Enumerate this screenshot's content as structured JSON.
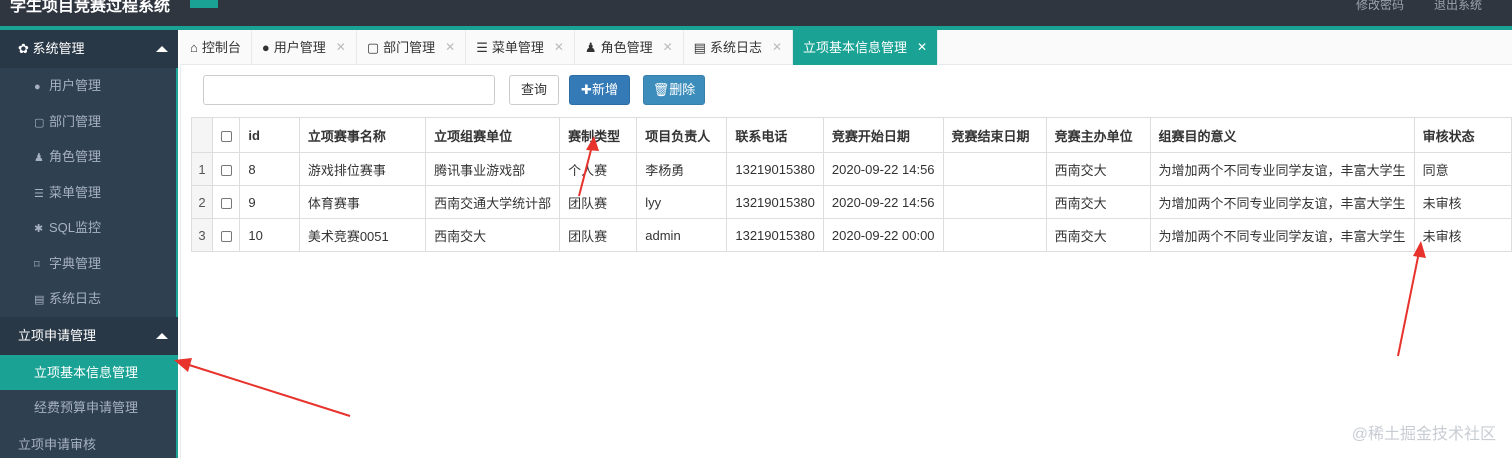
{
  "topbar": {
    "brand": "学生项目竞赛过程系统",
    "right_links": [
      "修改密码",
      "退出系统"
    ]
  },
  "sidebar": {
    "group1": {
      "label": "系统管理",
      "icon": "gear-icon"
    },
    "items": [
      {
        "label": "用户管理",
        "icon": "user-icon"
      },
      {
        "label": "部门管理",
        "icon": "doc-icon"
      },
      {
        "label": "角色管理",
        "icon": "users-icon"
      },
      {
        "label": "菜单管理",
        "icon": "list-icon"
      },
      {
        "label": "SQL监控",
        "icon": "bug-icon"
      },
      {
        "label": "字典管理",
        "icon": "bookmark-icon"
      },
      {
        "label": "系统日志",
        "icon": "file-icon"
      }
    ],
    "group2": {
      "label": "立项申请管理"
    },
    "sub_items": [
      {
        "label": "立项基本信息管理"
      },
      {
        "label": "经费预算申请管理"
      }
    ],
    "group3": {
      "label": "立项申请审核"
    }
  },
  "tabs": [
    {
      "label": "控制台",
      "icon": "home-icon",
      "closable": false
    },
    {
      "label": "用户管理",
      "icon": "user-icon",
      "closable": true
    },
    {
      "label": "部门管理",
      "icon": "doc-icon",
      "closable": true
    },
    {
      "label": "菜单管理",
      "icon": "list-icon",
      "closable": true
    },
    {
      "label": "角色管理",
      "icon": "users-icon",
      "closable": true
    },
    {
      "label": "系统日志",
      "icon": "file-icon",
      "closable": true
    },
    {
      "label": "立项基本信息管理",
      "icon": "",
      "closable": true
    }
  ],
  "toolbar": {
    "search_placeholder": "",
    "query_label": "查询",
    "add_label": "新增",
    "delete_label": "删除"
  },
  "table": {
    "headers": [
      "id",
      "立项赛事名称",
      "立项组赛单位",
      "赛制类型",
      "项目负责人",
      "联系电话",
      "竞赛开始日期",
      "竞赛结束日期",
      "竞赛主办单位",
      "组赛目的意义",
      "审核状态"
    ],
    "rows": [
      {
        "rn": "1",
        "cells": [
          "8",
          "游戏排位赛事",
          "腾讯事业游戏部",
          "个人赛",
          "李杨勇",
          "13219015380",
          "2020-09-22 14:56",
          "",
          "西南交大",
          "为增加两个不同专业同学友谊，丰富大学生",
          "同意"
        ]
      },
      {
        "rn": "2",
        "cells": [
          "9",
          "体育赛事",
          "西南交通大学统计部",
          "团队赛",
          "lyy",
          "13219015380",
          "2020-09-22 14:56",
          "",
          "西南交大",
          "为增加两个不同专业同学友谊，丰富大学生",
          "未审核"
        ]
      },
      {
        "rn": "3",
        "cells": [
          "10",
          "美术竞赛0051",
          "西南交大",
          "团队赛",
          "admin",
          "13219015380",
          "2020-09-22 00:00",
          "",
          "西南交大",
          "为增加两个不同专业同学友谊，丰富大学生",
          "未审核"
        ]
      }
    ]
  },
  "watermark": "@稀土掘金技术社区",
  "colors": {
    "accent": "#1aa394",
    "sidebar": "#2f4050",
    "annotation": "#e8322c"
  }
}
